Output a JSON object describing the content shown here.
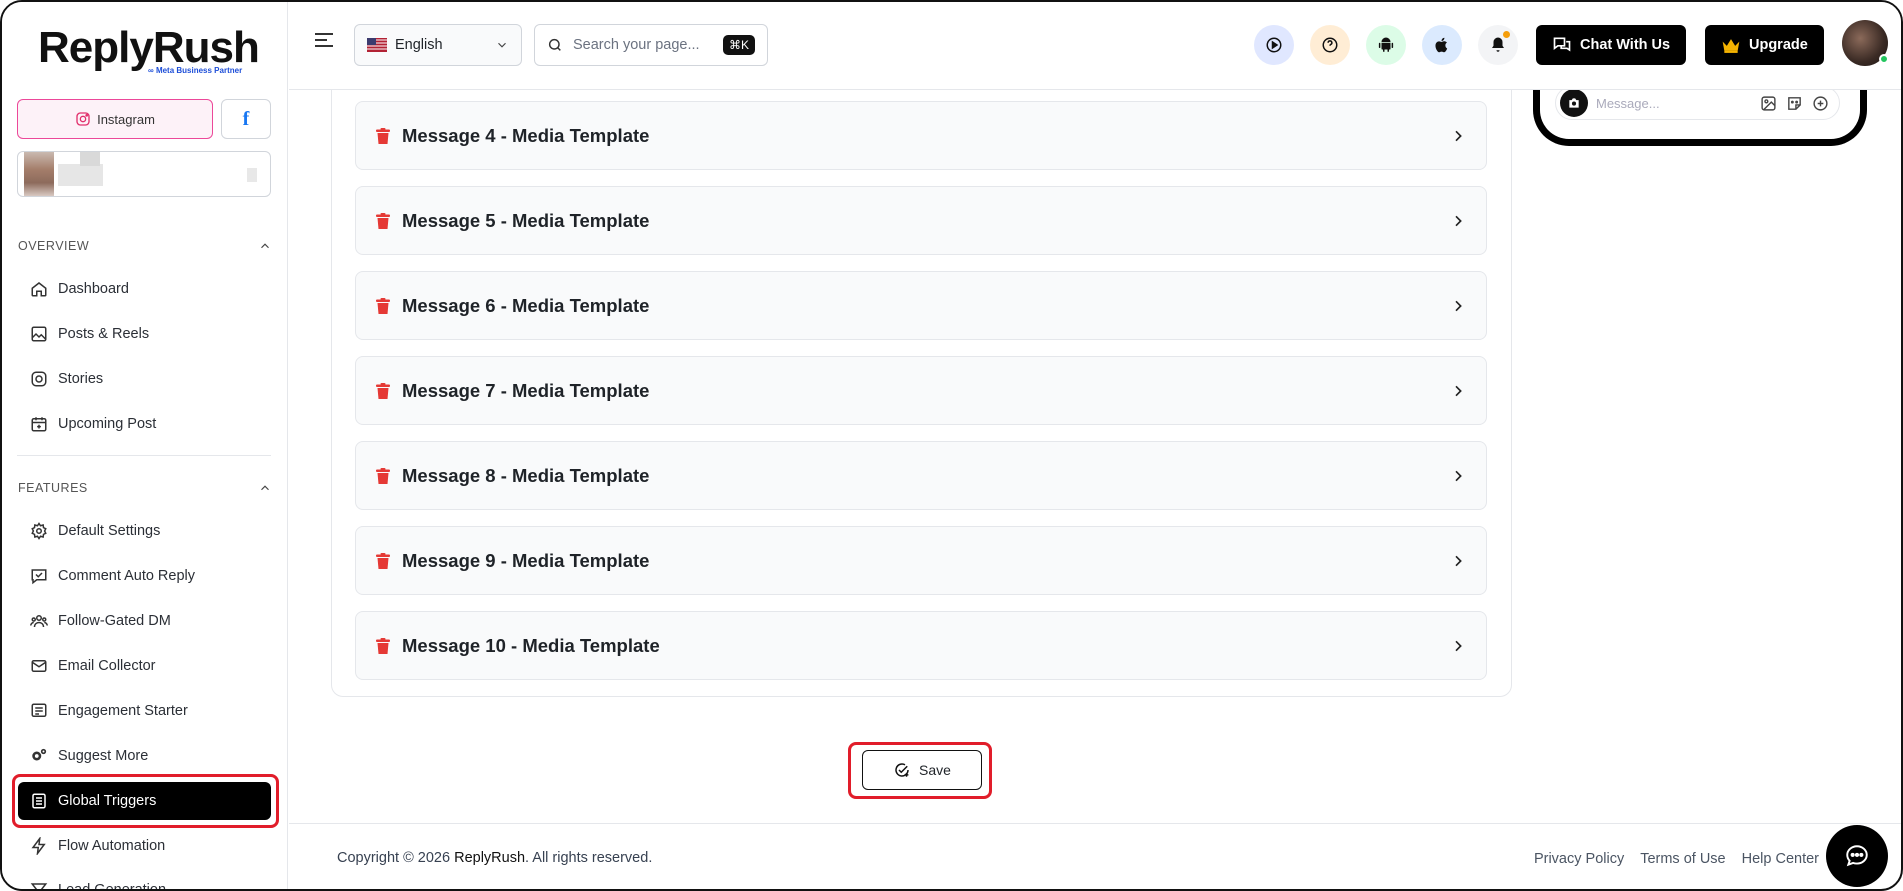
{
  "brand": {
    "name": "ReplyRush",
    "tagline": "Meta Business Partner"
  },
  "account_tabs": {
    "instagram": "Instagram",
    "facebook": "f"
  },
  "sidebar": {
    "overview_label": "OVERVIEW",
    "overview_items": [
      {
        "label": "Dashboard",
        "icon": "home-icon"
      },
      {
        "label": "Posts & Reels",
        "icon": "image-icon"
      },
      {
        "label": "Stories",
        "icon": "instagram-icon"
      },
      {
        "label": "Upcoming Post",
        "icon": "calendar-plus-icon"
      }
    ],
    "features_label": "FEATURES",
    "features_items": [
      {
        "label": "Default Settings",
        "icon": "gear-icon"
      },
      {
        "label": "Comment Auto Reply",
        "icon": "comment-icon"
      },
      {
        "label": "Follow-Gated DM",
        "icon": "users-icon"
      },
      {
        "label": "Email Collector",
        "icon": "mail-icon"
      },
      {
        "label": "Engagement Starter",
        "icon": "list-icon"
      },
      {
        "label": "Suggest More",
        "icon": "gears-icon"
      },
      {
        "label": "Global Triggers",
        "icon": "document-icon",
        "active": true
      },
      {
        "label": "Flow Automation",
        "icon": "bolt-icon"
      },
      {
        "label": "Lead Generation",
        "icon": "funnel-icon"
      }
    ]
  },
  "header": {
    "language": "English",
    "search_placeholder": "Search your page...",
    "search_shortcut": "⌘K",
    "chat_button": "Chat With Us",
    "upgrade_button": "Upgrade"
  },
  "messages": [
    "Message 4 - Media Template",
    "Message 5 - Media Template",
    "Message 6 - Media Template",
    "Message 7 - Media Template",
    "Message 8 - Media Template",
    "Message 9 - Media Template",
    "Message 10 - Media Template"
  ],
  "save_button": "Save",
  "phone_preview": {
    "message_placeholder": "Message..."
  },
  "footer": {
    "copyright_prefix": "Copyright © 2026 ",
    "copyright_brand": "ReplyRush",
    "copyright_suffix": ". All rights reserved.",
    "links": [
      "Privacy Policy",
      "Terms of Use",
      "Help Center"
    ]
  },
  "colors": {
    "accent_highlight": "#e11d2a",
    "active_nav_bg": "#000000",
    "delete_icon": "#e53935"
  }
}
